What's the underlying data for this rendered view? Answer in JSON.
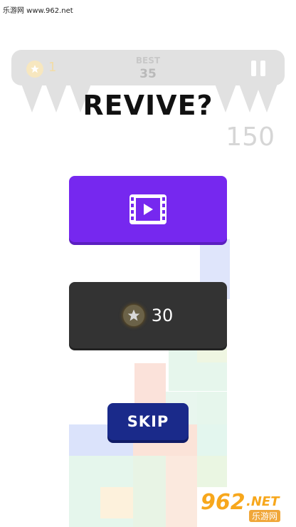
{
  "watermark": {
    "text": "乐游网 www.962.net"
  },
  "top_bar": {
    "coins": "1",
    "best_label": "BEST",
    "best_value": "35"
  },
  "game": {
    "title": "REVIVE?",
    "score": "150"
  },
  "buttons": {
    "watch_video_icon": "video-play-icon",
    "coin_cost": "30",
    "skip_label": "SKIP"
  },
  "logo": {
    "number": "962",
    "suffix": ".NET",
    "chinese": "乐游网"
  },
  "colors": {
    "video_button": "#7628ef",
    "coin_button": "#333333",
    "skip_button": "#1a2a8a",
    "coin_gold": "#f7e7bf"
  }
}
